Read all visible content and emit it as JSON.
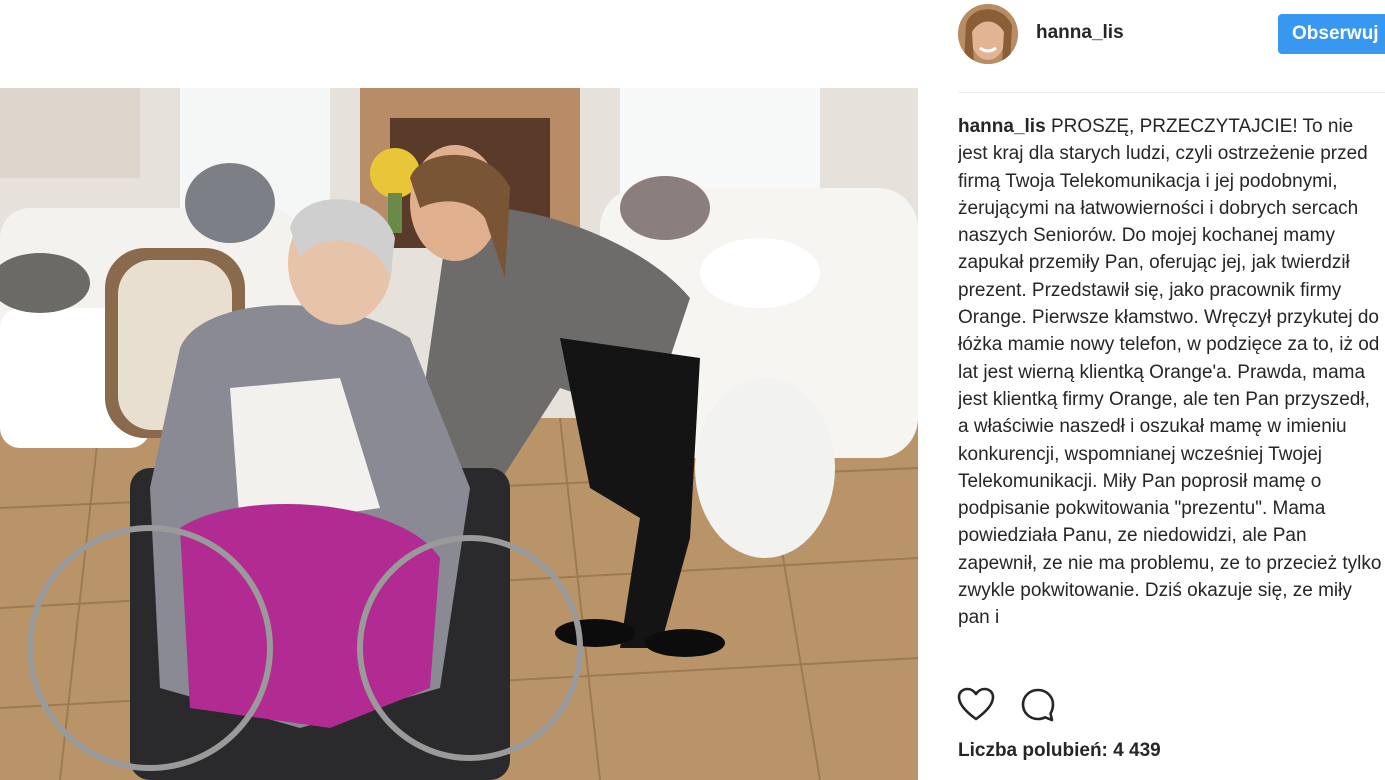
{
  "post": {
    "username": "hanna_lis",
    "follow_label": "Obserwuj",
    "caption_user": "hanna_lis",
    "caption_text": "PROSZĘ, PRZECZYTAJCIE! To nie jest kraj dla starych ludzi, czyli ostrzeżenie przed firmą Twoja Telekomunikacja i jej podobnymi, żerującymi na łatwowierności i dobrych sercach naszych Seniorów. Do mojej kochanej mamy zapukał przemiły Pan, oferując jej, jak twierdził prezent. Przedstawił się, jako pracownik firmy Orange. Pierwsze kłamstwo. Wręczył przykutej do łóżka mamie nowy telefon, w podzięce za to, iż od lat jest wierną klientką Orange'a. Prawda, mama jest klientką firmy Orange, ale ten Pan przyszedł, a właściwie naszedł i oszukał mamę w imieniu konkurencji, wspomnianej wcześniej Twojej Telekomunikacji. Miły Pan poprosił mamę o podpisanie pokwitowania \"prezentu\". Mama powiedziała Panu, ze niedowidzi, ale Pan zapewnił, ze nie ma problemu, ze to przecież tylko zwykle pokwitowanie. Dziś okazuje się, ze miły pan i",
    "likes_label": "Liczba polubień: 4 439"
  },
  "icons": {
    "like": "heart-icon",
    "comment": "comment-icon"
  },
  "colors": {
    "follow_button": "#3897f0",
    "text": "#262626",
    "divider": "#efefef"
  }
}
